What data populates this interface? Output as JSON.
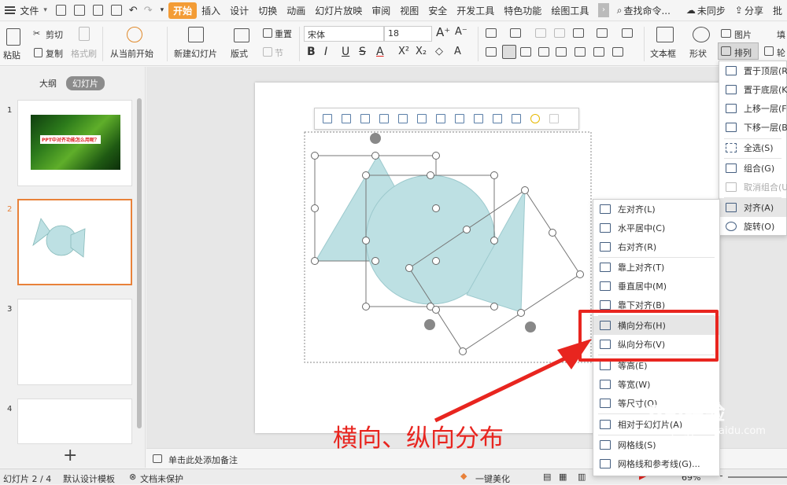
{
  "menubar": {
    "file_menu": "文件",
    "tabs": [
      "开始",
      "插入",
      "设计",
      "切换",
      "动画",
      "幻灯片放映",
      "审阅",
      "视图",
      "安全",
      "开发工具",
      "特色功能",
      "绘图工具"
    ],
    "search": "查找命令...",
    "sync": "未同步",
    "share": "分享",
    "annot": "批"
  },
  "ribbon": {
    "paste": "粘贴",
    "cut": "剪切",
    "copy": "复制",
    "format_painter": "格式刷",
    "play_from_current": "从当前开始",
    "new_slide": "新建幻灯片",
    "layout": "版式",
    "reset": "重置",
    "section": "节",
    "font_name": "宋体",
    "font_size": "18",
    "textbox": "文本框",
    "shape": "形状",
    "arrange": "排列",
    "picture": "图片",
    "fill": "填",
    "outline": "轮"
  },
  "left_pane": {
    "tab_outline": "大纲",
    "tab_slides": "幻灯片",
    "slide_numbers": [
      "1",
      "2",
      "3",
      "4"
    ],
    "thumb1_title": "PPT中对齐功能怎么用呢？",
    "add": "+"
  },
  "notes_placeholder": "单击此处添加备注",
  "status": {
    "slide_count": "幻灯片 2 / 4",
    "template": "默认设计模板",
    "doc_protect": "文档未保护",
    "beautify": "一键美化",
    "zoom": "69%"
  },
  "arrange_menu": {
    "items": [
      "置于顶层(R)",
      "置于底层(K)",
      "上移一层(F)",
      "下移一层(B)",
      "全选(S)",
      "组合(G)",
      "取消组合(U)",
      "对齐(A)",
      "旋转(O)"
    ]
  },
  "align_menu": {
    "items": [
      "左对齐(L)",
      "水平居中(C)",
      "右对齐(R)",
      "靠上对齐(T)",
      "垂直居中(M)",
      "靠下对齐(B)",
      "横向分布(H)",
      "纵向分布(V)",
      "等高(E)",
      "等宽(W)",
      "等尺寸(Q)",
      "相对于幻灯片(A)",
      "网格线(S)",
      "网格线和参考线(G)..."
    ]
  },
  "annotation": "横向、纵向分布",
  "watermark": {
    "main": "Bai经验",
    "sub": "jingyan.baidu.com"
  },
  "colors": {
    "accent_tab": "#f39c36",
    "shape_fill": "#bde0e3",
    "highlight_red": "#e8251f",
    "selected_thumb_border": "#e8813a"
  }
}
